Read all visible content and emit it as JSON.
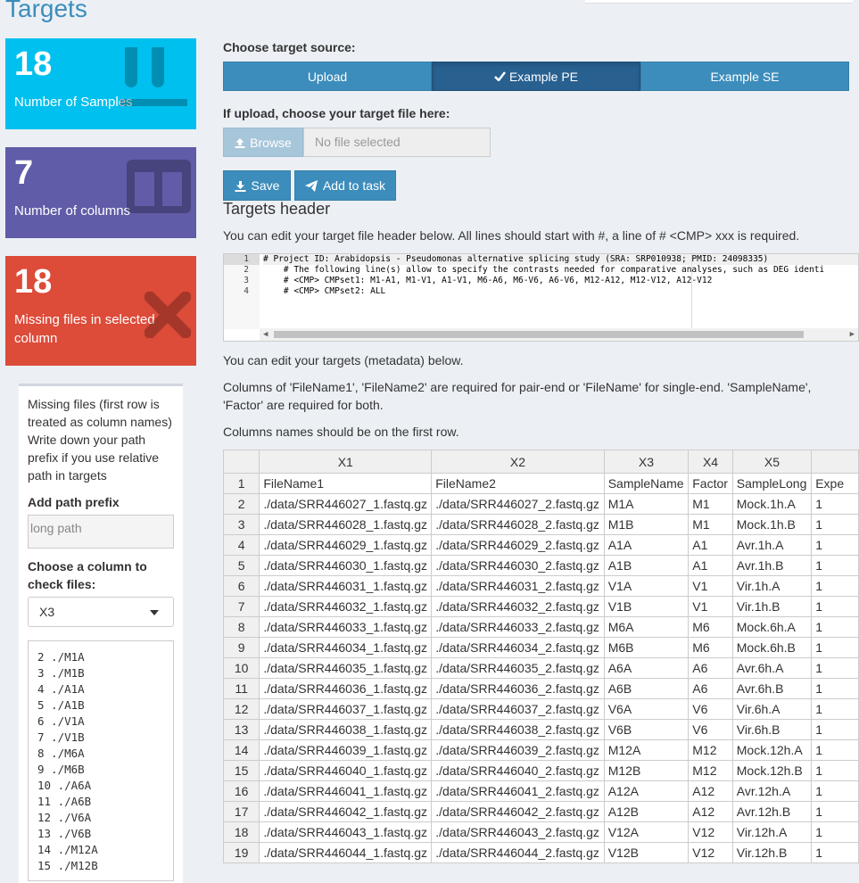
{
  "page": {
    "title": "Targets"
  },
  "value_boxes": [
    {
      "value": "18",
      "label": "Number of Samples",
      "icon": "vials-icon",
      "color": "#00c0ef"
    },
    {
      "value": "7",
      "label": "Number of columns",
      "icon": "columns-icon",
      "color": "#605ca8"
    },
    {
      "value": "18",
      "label": "Missing files in selected column",
      "icon": "times-icon",
      "color": "#dd4b39"
    }
  ],
  "side": {
    "help": "Missing files (first row is treated as column names) Write down your path prefix if you use relative path in targets",
    "prefix_label": "Add path prefix",
    "prefix_placeholder": "long path",
    "column_label": "Choose a column to check files:",
    "column_selected": "X3",
    "missing_files": [
      "2 ./M1A",
      "3 ./M1B",
      "4 ./A1A",
      "5 ./A1B",
      "6 ./V1A",
      "7 ./V1B",
      "8 ./M6A",
      "9 ./M6B",
      "10 ./A6A",
      "11 ./A6B",
      "12 ./V6A",
      "13 ./V6B",
      "14 ./M12A",
      "15 ./M12B"
    ]
  },
  "source": {
    "label": "Choose target source:",
    "options": [
      "Upload",
      "Example PE",
      "Example SE"
    ],
    "selected": "Example PE"
  },
  "upload": {
    "label": "If upload, choose your target file here:",
    "browse_label": "Browse",
    "file_placeholder": "No file selected"
  },
  "actions": {
    "save_label": "Save",
    "add_task_label": "Add to task"
  },
  "header_section": {
    "title": "Targets header",
    "desc": "You can edit your target file header below. All lines should start with #, a line of # <CMP> xxx is required.",
    "lines": [
      "# Project ID: Arabidopsis - Pseudomonas alternative splicing study (SRA: SRP010938; PMID: 24098335)",
      "    # The following line(s) allow to specify the contrasts needed for comparative analyses, such as DEG identi",
      "    # <CMP> CMPset1: M1-A1, M1-V1, A1-V1, M6-A6, M6-V6, A6-V6, M12-A12, M12-V12, A12-V12",
      "    # <CMP> CMPset2: ALL"
    ]
  },
  "meta_text": {
    "edit": "You can edit your targets (metadata) below.",
    "required": "Columns of 'FileName1', 'FileName2' are required for pair-end or 'FileName' for single-end. 'SampleName', 'Factor' are required for both.",
    "first_row": "Columns names should be on the first row."
  },
  "table": {
    "columns": [
      "X1",
      "X2",
      "X3",
      "X4",
      "X5",
      ""
    ],
    "rows": [
      [
        "1",
        "FileName1",
        "FileName2",
        "SampleName",
        "Factor",
        "SampleLong",
        "Expe"
      ],
      [
        "2",
        "./data/SRR446027_1.fastq.gz",
        "./data/SRR446027_2.fastq.gz",
        "M1A",
        "M1",
        "Mock.1h.A",
        "1"
      ],
      [
        "3",
        "./data/SRR446028_1.fastq.gz",
        "./data/SRR446028_2.fastq.gz",
        "M1B",
        "M1",
        "Mock.1h.B",
        "1"
      ],
      [
        "4",
        "./data/SRR446029_1.fastq.gz",
        "./data/SRR446029_2.fastq.gz",
        "A1A",
        "A1",
        "Avr.1h.A",
        "1"
      ],
      [
        "5",
        "./data/SRR446030_1.fastq.gz",
        "./data/SRR446030_2.fastq.gz",
        "A1B",
        "A1",
        "Avr.1h.B",
        "1"
      ],
      [
        "6",
        "./data/SRR446031_1.fastq.gz",
        "./data/SRR446031_2.fastq.gz",
        "V1A",
        "V1",
        "Vir.1h.A",
        "1"
      ],
      [
        "7",
        "./data/SRR446032_1.fastq.gz",
        "./data/SRR446032_2.fastq.gz",
        "V1B",
        "V1",
        "Vir.1h.B",
        "1"
      ],
      [
        "8",
        "./data/SRR446033_1.fastq.gz",
        "./data/SRR446033_2.fastq.gz",
        "M6A",
        "M6",
        "Mock.6h.A",
        "1"
      ],
      [
        "9",
        "./data/SRR446034_1.fastq.gz",
        "./data/SRR446034_2.fastq.gz",
        "M6B",
        "M6",
        "Mock.6h.B",
        "1"
      ],
      [
        "10",
        "./data/SRR446035_1.fastq.gz",
        "./data/SRR446035_2.fastq.gz",
        "A6A",
        "A6",
        "Avr.6h.A",
        "1"
      ],
      [
        "11",
        "./data/SRR446036_1.fastq.gz",
        "./data/SRR446036_2.fastq.gz",
        "A6B",
        "A6",
        "Avr.6h.B",
        "1"
      ],
      [
        "12",
        "./data/SRR446037_1.fastq.gz",
        "./data/SRR446037_2.fastq.gz",
        "V6A",
        "V6",
        "Vir.6h.A",
        "1"
      ],
      [
        "13",
        "./data/SRR446038_1.fastq.gz",
        "./data/SRR446038_2.fastq.gz",
        "V6B",
        "V6",
        "Vir.6h.B",
        "1"
      ],
      [
        "14",
        "./data/SRR446039_1.fastq.gz",
        "./data/SRR446039_2.fastq.gz",
        "M12A",
        "M12",
        "Mock.12h.A",
        "1"
      ],
      [
        "15",
        "./data/SRR446040_1.fastq.gz",
        "./data/SRR446040_2.fastq.gz",
        "M12B",
        "M12",
        "Mock.12h.B",
        "1"
      ],
      [
        "16",
        "./data/SRR446041_1.fastq.gz",
        "./data/SRR446041_2.fastq.gz",
        "A12A",
        "A12",
        "Avr.12h.A",
        "1"
      ],
      [
        "17",
        "./data/SRR446042_1.fastq.gz",
        "./data/SRR446042_2.fastq.gz",
        "A12B",
        "A12",
        "Avr.12h.B",
        "1"
      ],
      [
        "18",
        "./data/SRR446043_1.fastq.gz",
        "./data/SRR446043_2.fastq.gz",
        "V12A",
        "V12",
        "Vir.12h.A",
        "1"
      ],
      [
        "19",
        "./data/SRR446044_1.fastq.gz",
        "./data/SRR446044_2.fastq.gz",
        "V12B",
        "V12",
        "Vir.12h.B",
        "1"
      ]
    ]
  }
}
